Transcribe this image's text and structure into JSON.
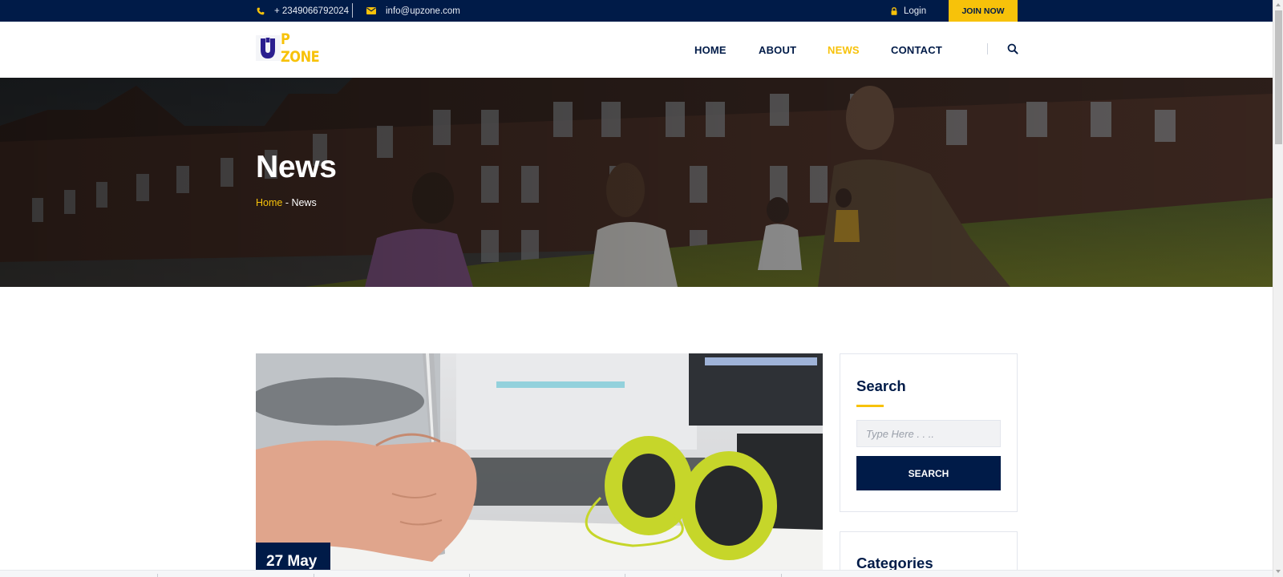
{
  "topbar": {
    "phone": "+ 2349066792024",
    "email": "info@upzone.com",
    "login_label": "Login",
    "join_label": "JOIN NOW",
    "icons": {
      "phone": "phone-icon",
      "email": "envelope-icon",
      "login": "lock-icon"
    }
  },
  "header": {
    "logo_text": "P ZONE",
    "nav": [
      "HOME",
      "ABOUT",
      "NEWS",
      "CONTACT"
    ],
    "active_nav": "NEWS",
    "search_icon": "search-icon"
  },
  "hero": {
    "title": "News",
    "breadcrumb": {
      "home": "Home",
      "separator": " - ",
      "current": "News"
    }
  },
  "post": {
    "date": "27 May"
  },
  "sidebar": {
    "search": {
      "title": "Search",
      "placeholder": "Type Here . . ..",
      "button_label": "SEARCH"
    },
    "categories": {
      "title": "Categories"
    }
  },
  "colors": {
    "navy": "#001b48",
    "accent_yellow": "#f7c20a",
    "white": "#ffffff"
  }
}
